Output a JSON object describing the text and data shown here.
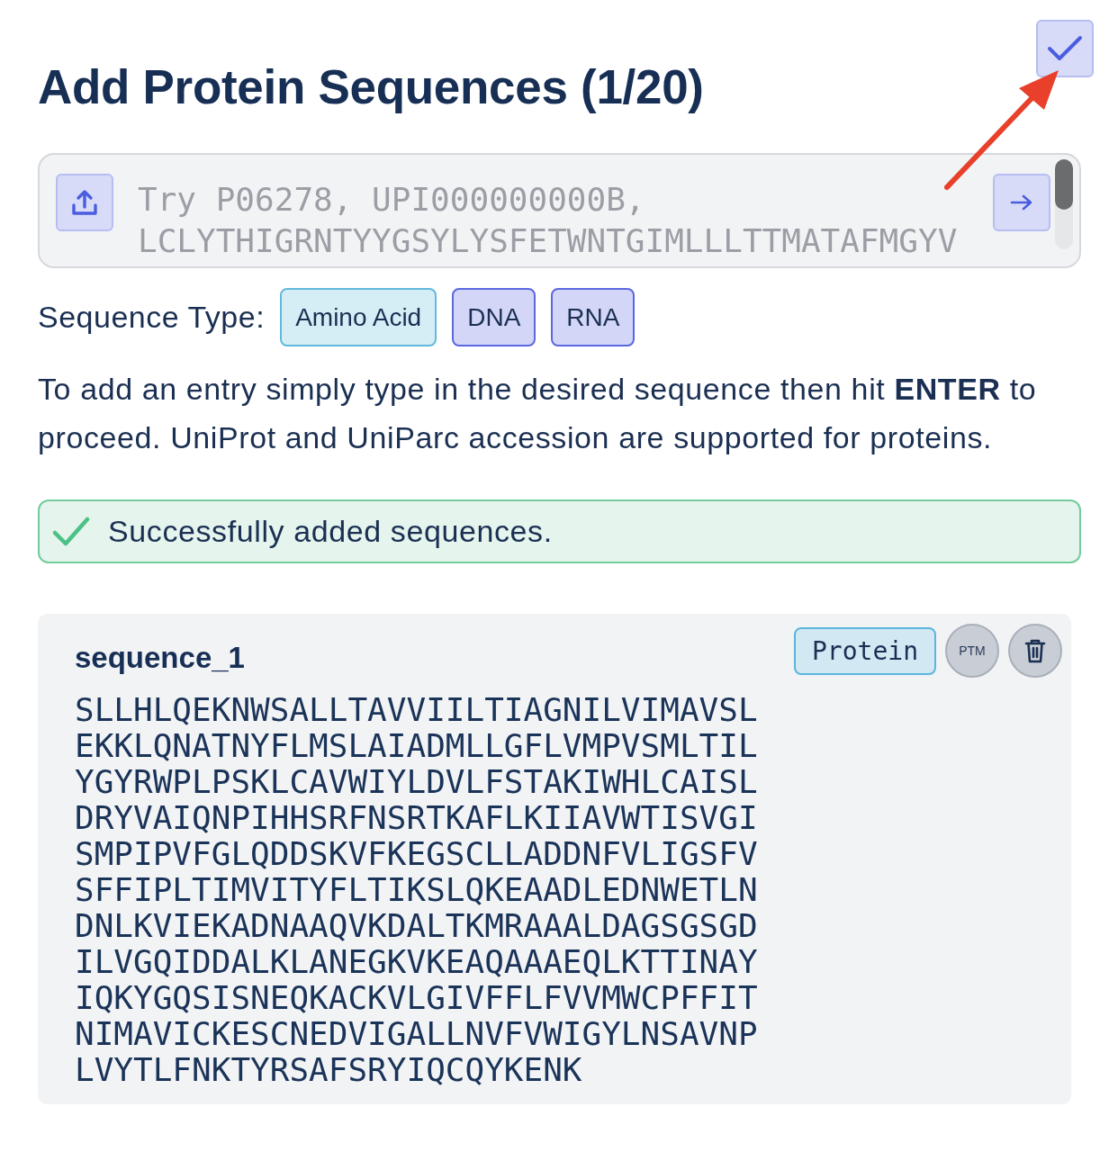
{
  "title": "Add Protein Sequences (1/20)",
  "input": {
    "placeholder": "Try P06278, UPI000000000B, LCLYTHIGRNTYYGSYLYSFETWNTGIMLLLTTMATAFMGYV"
  },
  "sequence_type": {
    "label": "Sequence Type:",
    "options": [
      {
        "label": "Amino Acid",
        "selected": true
      },
      {
        "label": "DNA",
        "selected": false
      },
      {
        "label": "RNA",
        "selected": false
      }
    ]
  },
  "instructions": "To add an entry simply type in the desired sequence then hit **ENTER** to proceed. UniProt and UniParc accession are supported for proteins.",
  "alert": {
    "kind": "success",
    "message": "Successfully added sequences."
  },
  "sequences": [
    {
      "name": "sequence_1",
      "type": "Protein",
      "ptm_button": "PTM",
      "residues": "SLLHLQEKNWSALLTAVVIILTIAGNILVIMAVSLEKKLQNATNYFLMSLAIADMLLGFLVMPVSMLTILYGYRWPLPSKLCAVWIYLDVLFSTAKIWHLCAISLDRYVAIQNPIHHSRFNSRTKAFLKIIAVWTISVGISMPIPVFGLQDDSKVFKEGSCLLADDNFVLIGSFVSFFIPLTIMVITYFLTIKSLQKEAADLEDNWETLNDNLKVIEKADNAAQVKDALTKMRAAALDAGSGSGDILVGQIDDALKLANEGKVKEAQAAAEQLKTTINAYIQKYGQSISNEQKACKVLGIVFFLFVVMWCPFFITNIMAVICKESCNEDVIGALLNVFVWIGYLNSAVNPLVYTLFNKTYRSAFSRYIQCQYKENK"
    }
  ]
}
